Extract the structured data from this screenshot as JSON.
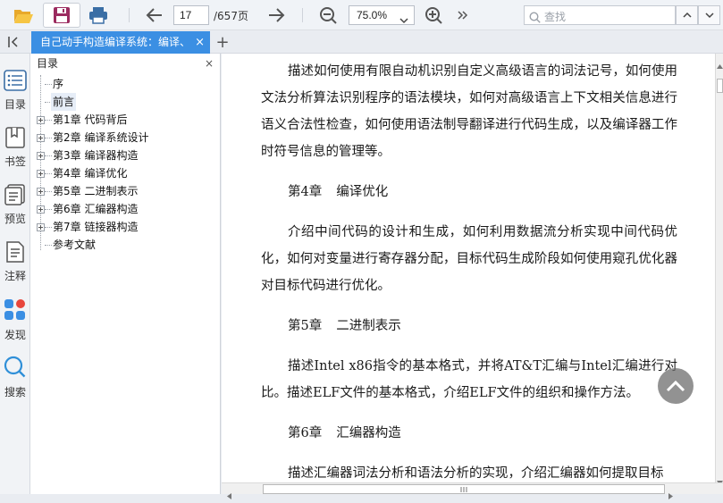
{
  "toolbar": {
    "open_icon": "folder-open-icon",
    "save_icon": "save-icon",
    "print_icon": "print-icon",
    "prev_icon": "arrow-left-icon",
    "current_page": "17",
    "total_pages": "/657页",
    "next_icon": "arrow-right-icon",
    "zoom_out_icon": "zoom-out-icon",
    "zoom_value": "75.0%",
    "zoom_in_icon": "zoom-in-icon",
    "more_icon": "double-chevron-right-icon",
    "search_placeholder": "查找"
  },
  "tabs": {
    "collapse_icon": "collapse-panel-icon",
    "doc_tab_title": "自己动手构造编译系统：编译、",
    "close": "×",
    "add": "+"
  },
  "rail": [
    {
      "label": "目录",
      "icon": "toc-icon"
    },
    {
      "label": "书签",
      "icon": "bookmark-icon"
    },
    {
      "label": "预览",
      "icon": "preview-icon"
    },
    {
      "label": "注释",
      "icon": "annotation-icon"
    },
    {
      "label": "发现",
      "icon": "discover-icon"
    },
    {
      "label": "搜索",
      "icon": "search-icon"
    }
  ],
  "outline": {
    "title": "目录",
    "close": "×",
    "items": [
      {
        "label": "序",
        "expandable": false
      },
      {
        "label": "前言",
        "expandable": false
      },
      {
        "label": "第1章 代码背后",
        "expandable": true
      },
      {
        "label": "第2章 编译系统设计",
        "expandable": true
      },
      {
        "label": "第3章 编译器构造",
        "expandable": true
      },
      {
        "label": "第4章 编译优化",
        "expandable": true
      },
      {
        "label": "第5章 二进制表示",
        "expandable": true
      },
      {
        "label": "第6章 汇编器构造",
        "expandable": true
      },
      {
        "label": "第7章 链接器构造",
        "expandable": true
      },
      {
        "label": "参考文献",
        "expandable": false
      }
    ]
  },
  "document": {
    "para1": "描述如何使用有限自动机识别自定义高级语言的词法记号，如何使用文法分析算法识别程序的语法模块，如何对高级语言上下文相关信息进行语义合法性检查，如何使用语法制导翻译进行代码生成，以及编译器工作时符号信息的管理等。",
    "ch4_num": "第4章",
    "ch4_title": "编译优化",
    "para2": "介绍中间代码的设计和生成，如何利用数据流分析实现中间代码优化，如何对变量进行寄存器分配，目标代码生成阶段如何使用窥孔优化器对目标代码进行优化。",
    "ch5_num": "第5章",
    "ch5_title": "二进制表示",
    "para3": "描述Intel x86指令的基本格式，并将AT&T汇编与Intel汇编进行对比。描述ELF文件的基本格式，介绍ELF文件的组织和操作方法。",
    "ch6_num": "第6章",
    "ch6_title": "汇编器构造",
    "para4": "描述汇编器词法分析和语法分析的实现，介绍汇编器如何提取目标"
  },
  "back_to_top_icon": "chevron-up-icon",
  "colors": {
    "tab_active": "#3b8fe3",
    "rail_discover_red": "#e8463c",
    "rail_discover_blue": "#3b8fe3"
  }
}
